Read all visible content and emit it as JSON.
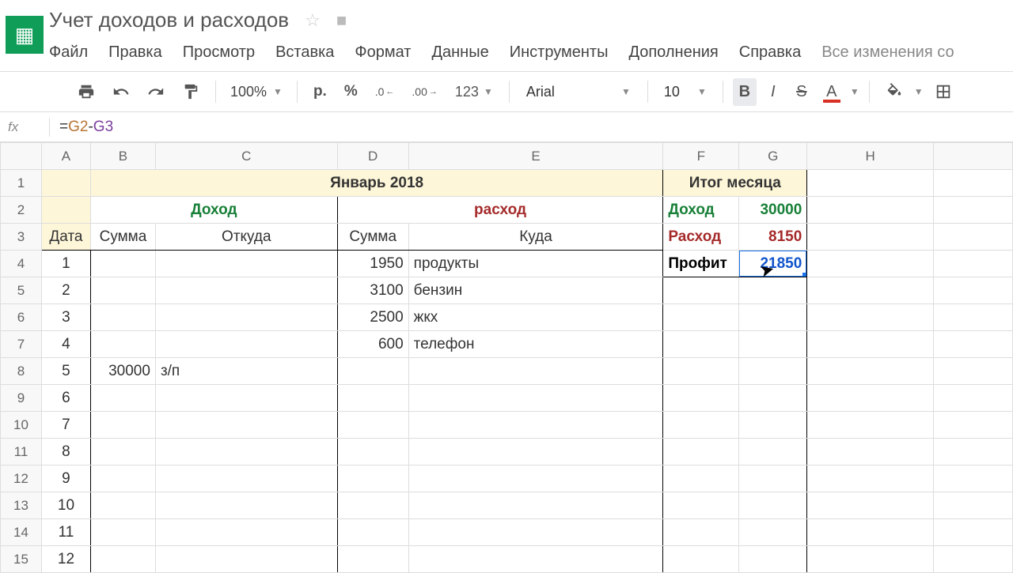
{
  "doc": {
    "title": "Учет доходов и расходов"
  },
  "menu": {
    "file": "Файл",
    "edit": "Правка",
    "view": "Просмотр",
    "insert": "Вставка",
    "format": "Формат",
    "data": "Данные",
    "tools": "Инструменты",
    "addons": "Дополнения",
    "help": "Справка",
    "saved": "Все изменения со"
  },
  "toolbar": {
    "zoom": "100%",
    "currency": "р.",
    "percent": "%",
    "dec_less": ".0←",
    "dec_more": ".00→",
    "numfmt": "123",
    "font": "Arial",
    "fontsize": "10",
    "bold": "B",
    "italic": "I",
    "strike": "S",
    "textcolor": "A"
  },
  "formula": {
    "fx": "fx",
    "eq": "=",
    "ref1": "G2",
    "minus": "-",
    "ref2": "G3"
  },
  "cols": [
    "A",
    "B",
    "C",
    "D",
    "E",
    "F",
    "G",
    "H"
  ],
  "sheet": {
    "month_title": "Январь 2018",
    "summary_title": "Итог месяца",
    "income_label": "Доход",
    "expense_label": "расход",
    "date_label": "Дата",
    "sum_label": "Сумма",
    "from_label": "Откуда",
    "to_label": "Куда",
    "summary_income_label": "Доход",
    "summary_income_val": "30000",
    "summary_expense_label": "Расход",
    "summary_expense_val": "8150",
    "summary_profit_label": "Профит",
    "summary_profit_val": "21850",
    "rows": [
      {
        "n": "1",
        "date": "1",
        "inc_sum": "",
        "inc_from": "",
        "exp_sum": "1950",
        "exp_to": "продукты"
      },
      {
        "n": "2",
        "date": "2",
        "inc_sum": "",
        "inc_from": "",
        "exp_sum": "3100",
        "exp_to": "бензин"
      },
      {
        "n": "3",
        "date": "3",
        "inc_sum": "",
        "inc_from": "",
        "exp_sum": "2500",
        "exp_to": "жкх"
      },
      {
        "n": "4",
        "date": "4",
        "inc_sum": "",
        "inc_from": "",
        "exp_sum": "600",
        "exp_to": "телефон"
      },
      {
        "n": "5",
        "date": "5",
        "inc_sum": "30000",
        "inc_from": "з/п",
        "exp_sum": "",
        "exp_to": ""
      },
      {
        "n": "6",
        "date": "6",
        "inc_sum": "",
        "inc_from": "",
        "exp_sum": "",
        "exp_to": ""
      },
      {
        "n": "7",
        "date": "7",
        "inc_sum": "",
        "inc_from": "",
        "exp_sum": "",
        "exp_to": ""
      },
      {
        "n": "8",
        "date": "8",
        "inc_sum": "",
        "inc_from": "",
        "exp_sum": "",
        "exp_to": ""
      },
      {
        "n": "9",
        "date": "9",
        "inc_sum": "",
        "inc_from": "",
        "exp_sum": "",
        "exp_to": ""
      },
      {
        "n": "10",
        "date": "10",
        "inc_sum": "",
        "inc_from": "",
        "exp_sum": "",
        "exp_to": ""
      },
      {
        "n": "11",
        "date": "11",
        "inc_sum": "",
        "inc_from": "",
        "exp_sum": "",
        "exp_to": ""
      },
      {
        "n": "12",
        "date": "12",
        "inc_sum": "",
        "inc_from": "",
        "exp_sum": "",
        "exp_to": ""
      }
    ]
  }
}
